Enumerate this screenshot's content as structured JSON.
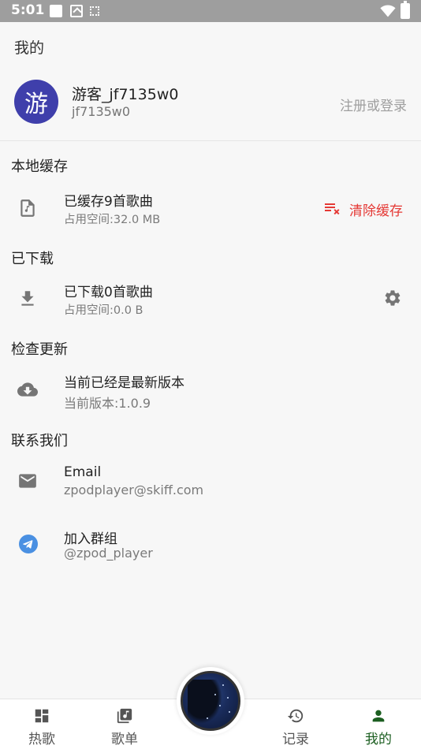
{
  "status_bar": {
    "time": "5:01"
  },
  "page": {
    "title": "我的"
  },
  "profile": {
    "avatar_char": "游",
    "username": "游客_jf7135w0",
    "user_id": "jf7135w0",
    "login_label": "注册或登录"
  },
  "cache": {
    "section_title": "本地缓存",
    "title": "已缓存9首歌曲",
    "subtitle": "占用空间:32.0 MB",
    "clear_label": "清除缓存"
  },
  "downloads": {
    "section_title": "已下载",
    "title": "已下载0首歌曲",
    "subtitle": "占用空间:0.0 B"
  },
  "update": {
    "section_title": "检查更新",
    "title": "当前已经是最新版本",
    "subtitle": "当前版本:1.0.9"
  },
  "contact": {
    "section_title": "联系我们",
    "email_title": "Email",
    "email_value": "zpodplayer@skiff.com",
    "group_title": "加入群组",
    "group_value": "@zpod_player"
  },
  "nav": {
    "items": [
      {
        "label": "热歌",
        "icon": "dashboard-icon"
      },
      {
        "label": "歌单",
        "icon": "library-music-icon"
      },
      {
        "label": "记录",
        "icon": "history-icon"
      },
      {
        "label": "我的",
        "icon": "person-icon"
      }
    ]
  },
  "colors": {
    "accent": "#1b5e20",
    "danger": "#e53935",
    "avatar_bg": "#3f3fab",
    "telegram": "#4a90e2"
  }
}
